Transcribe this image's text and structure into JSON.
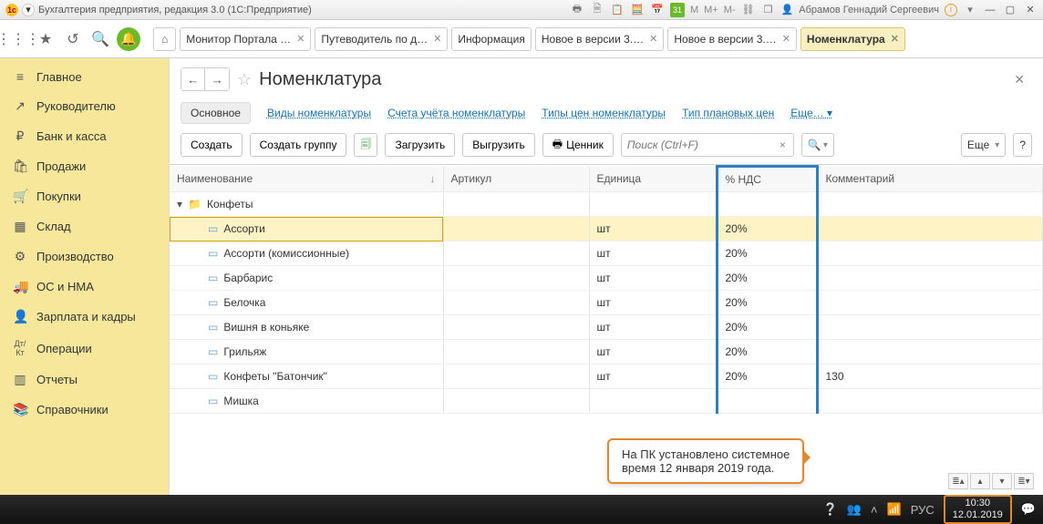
{
  "window": {
    "title": "Бухгалтерия предприятия, редакция 3.0  (1С:Предприятие)",
    "user": "Абрамов Геннадий Сергеевич",
    "letters": [
      "M",
      "M+",
      "M-"
    ]
  },
  "tabs": [
    {
      "label": "Монитор Портала …"
    },
    {
      "label": "Путеводитель по д…"
    },
    {
      "label": "Информация"
    },
    {
      "label": "Новое в версии 3.…"
    },
    {
      "label": "Новое в версии 3.…"
    },
    {
      "label": "Номенклатура",
      "active": true
    }
  ],
  "sidebar": [
    {
      "icon": "≡",
      "label": "Главное"
    },
    {
      "icon": "↗",
      "label": "Руководителю"
    },
    {
      "icon": "₽",
      "label": "Банк и касса"
    },
    {
      "icon": "🛍",
      "label": "Продажи"
    },
    {
      "icon": "🛒",
      "label": "Покупки"
    },
    {
      "icon": "▦",
      "label": "Склад"
    },
    {
      "icon": "⚙",
      "label": "Производство"
    },
    {
      "icon": "🚚",
      "label": "ОС и НМА"
    },
    {
      "icon": "👤",
      "label": "Зарплата и кадры"
    },
    {
      "icon": "Дт/Кт",
      "label": "Операции"
    },
    {
      "icon": "▥",
      "label": "Отчеты"
    },
    {
      "icon": "📚",
      "label": "Справочники"
    }
  ],
  "page": {
    "title": "Номенклатура",
    "subnav_main": "Основное",
    "subnav_links": [
      "Виды номенклатуры",
      "Счета учёта номенклатуры",
      "Типы цен номенклатуры",
      "Тип плановых цен"
    ],
    "subnav_more": "Еще…",
    "toolbar": {
      "create": "Создать",
      "create_group": "Создать группу",
      "load": "Загрузить",
      "unload": "Выгрузить",
      "price": "Ценник",
      "search_placeholder": "Поиск (Ctrl+F)",
      "more": "Еще"
    },
    "columns": [
      "Наименование",
      "Артикул",
      "Единица",
      "% НДС",
      "Комментарий"
    ],
    "group": "Конфеты",
    "rows": [
      {
        "name": "Ассорти",
        "unit": "шт",
        "nds": "20%",
        "comment": "",
        "sel": true
      },
      {
        "name": "Ассорти (комиссионные)",
        "unit": "шт",
        "nds": "20%",
        "comment": ""
      },
      {
        "name": "Барбарис",
        "unit": "шт",
        "nds": "20%",
        "comment": ""
      },
      {
        "name": "Белочка",
        "unit": "шт",
        "nds": "20%",
        "comment": ""
      },
      {
        "name": "Вишня в коньяке",
        "unit": "шт",
        "nds": "20%",
        "comment": ""
      },
      {
        "name": "Грильяж",
        "unit": "шт",
        "nds": "20%",
        "comment": ""
      },
      {
        "name": "Конфеты \"Батончик\"",
        "unit": "шт",
        "nds": "20%",
        "comment": "130"
      },
      {
        "name": "Мишка",
        "unit": "",
        "nds": "",
        "comment": ""
      }
    ],
    "callout_l1": "На ПК установлено системное",
    "callout_l2": "время 12 января  2019 года."
  },
  "taskbar": {
    "lang": "РУС",
    "time": "10:30",
    "date": "12.01.2019"
  }
}
